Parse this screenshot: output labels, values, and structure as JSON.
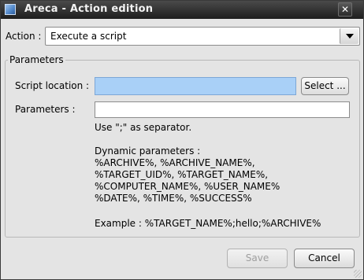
{
  "window": {
    "title": "Areca - Action edition"
  },
  "action": {
    "label": "Action :",
    "selected": "Execute a script"
  },
  "parameters_group": {
    "title": "Parameters",
    "script_location_label": "Script location :",
    "script_location_value": "",
    "select_button": "Select ...",
    "parameters_label": "Parameters :",
    "parameters_value": "",
    "separator_hint": "Use \";\" as separator.",
    "dynamic_title": "Dynamic parameters :",
    "dynamic_lines": [
      "%ARCHIVE%, %ARCHIVE_NAME%,",
      "%TARGET_UID%, %TARGET_NAME%,",
      "%COMPUTER_NAME%, %USER_NAME%",
      "%DATE%, %TIME%, %SUCCESS%"
    ],
    "example": "Example : %TARGET_NAME%;hello;%ARCHIVE%"
  },
  "footer": {
    "save_label": "Save",
    "cancel_label": "Cancel"
  },
  "colors": {
    "title_bar": "#2b2b2b",
    "window_bg": "#e4e4e4",
    "focused_field": "#a9d0f7"
  },
  "icons": [
    "app-icon",
    "close-icon",
    "chevron-down-icon"
  ]
}
